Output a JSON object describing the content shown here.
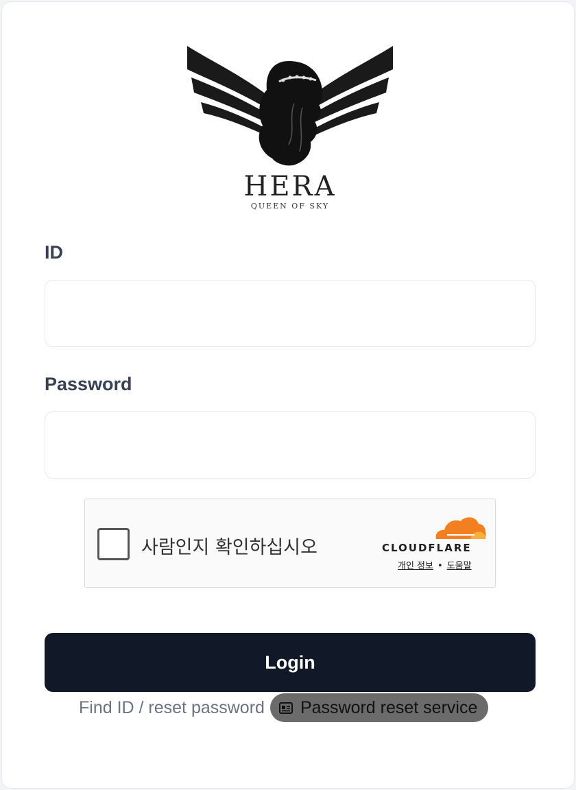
{
  "brand": {
    "name": "HERA",
    "tagline": "QUEEN OF SKY"
  },
  "form": {
    "id_label": "ID",
    "id_value": "",
    "password_label": "Password",
    "password_value": "",
    "login_label": "Login"
  },
  "captcha": {
    "text": "사람인지 확인하십시오",
    "provider": "CLOUDFLARE",
    "privacy_link": "개인 정보",
    "separator": "•",
    "help_link": "도움말",
    "accent_color": "#f38020"
  },
  "footer": {
    "find_link": "Find ID / reset password",
    "reset_service": "Password reset service",
    "reset_icon": "document-icon"
  },
  "colors": {
    "primary_button": "#111827",
    "label_text": "#374151",
    "pill_bg": "#6b6b6b"
  }
}
